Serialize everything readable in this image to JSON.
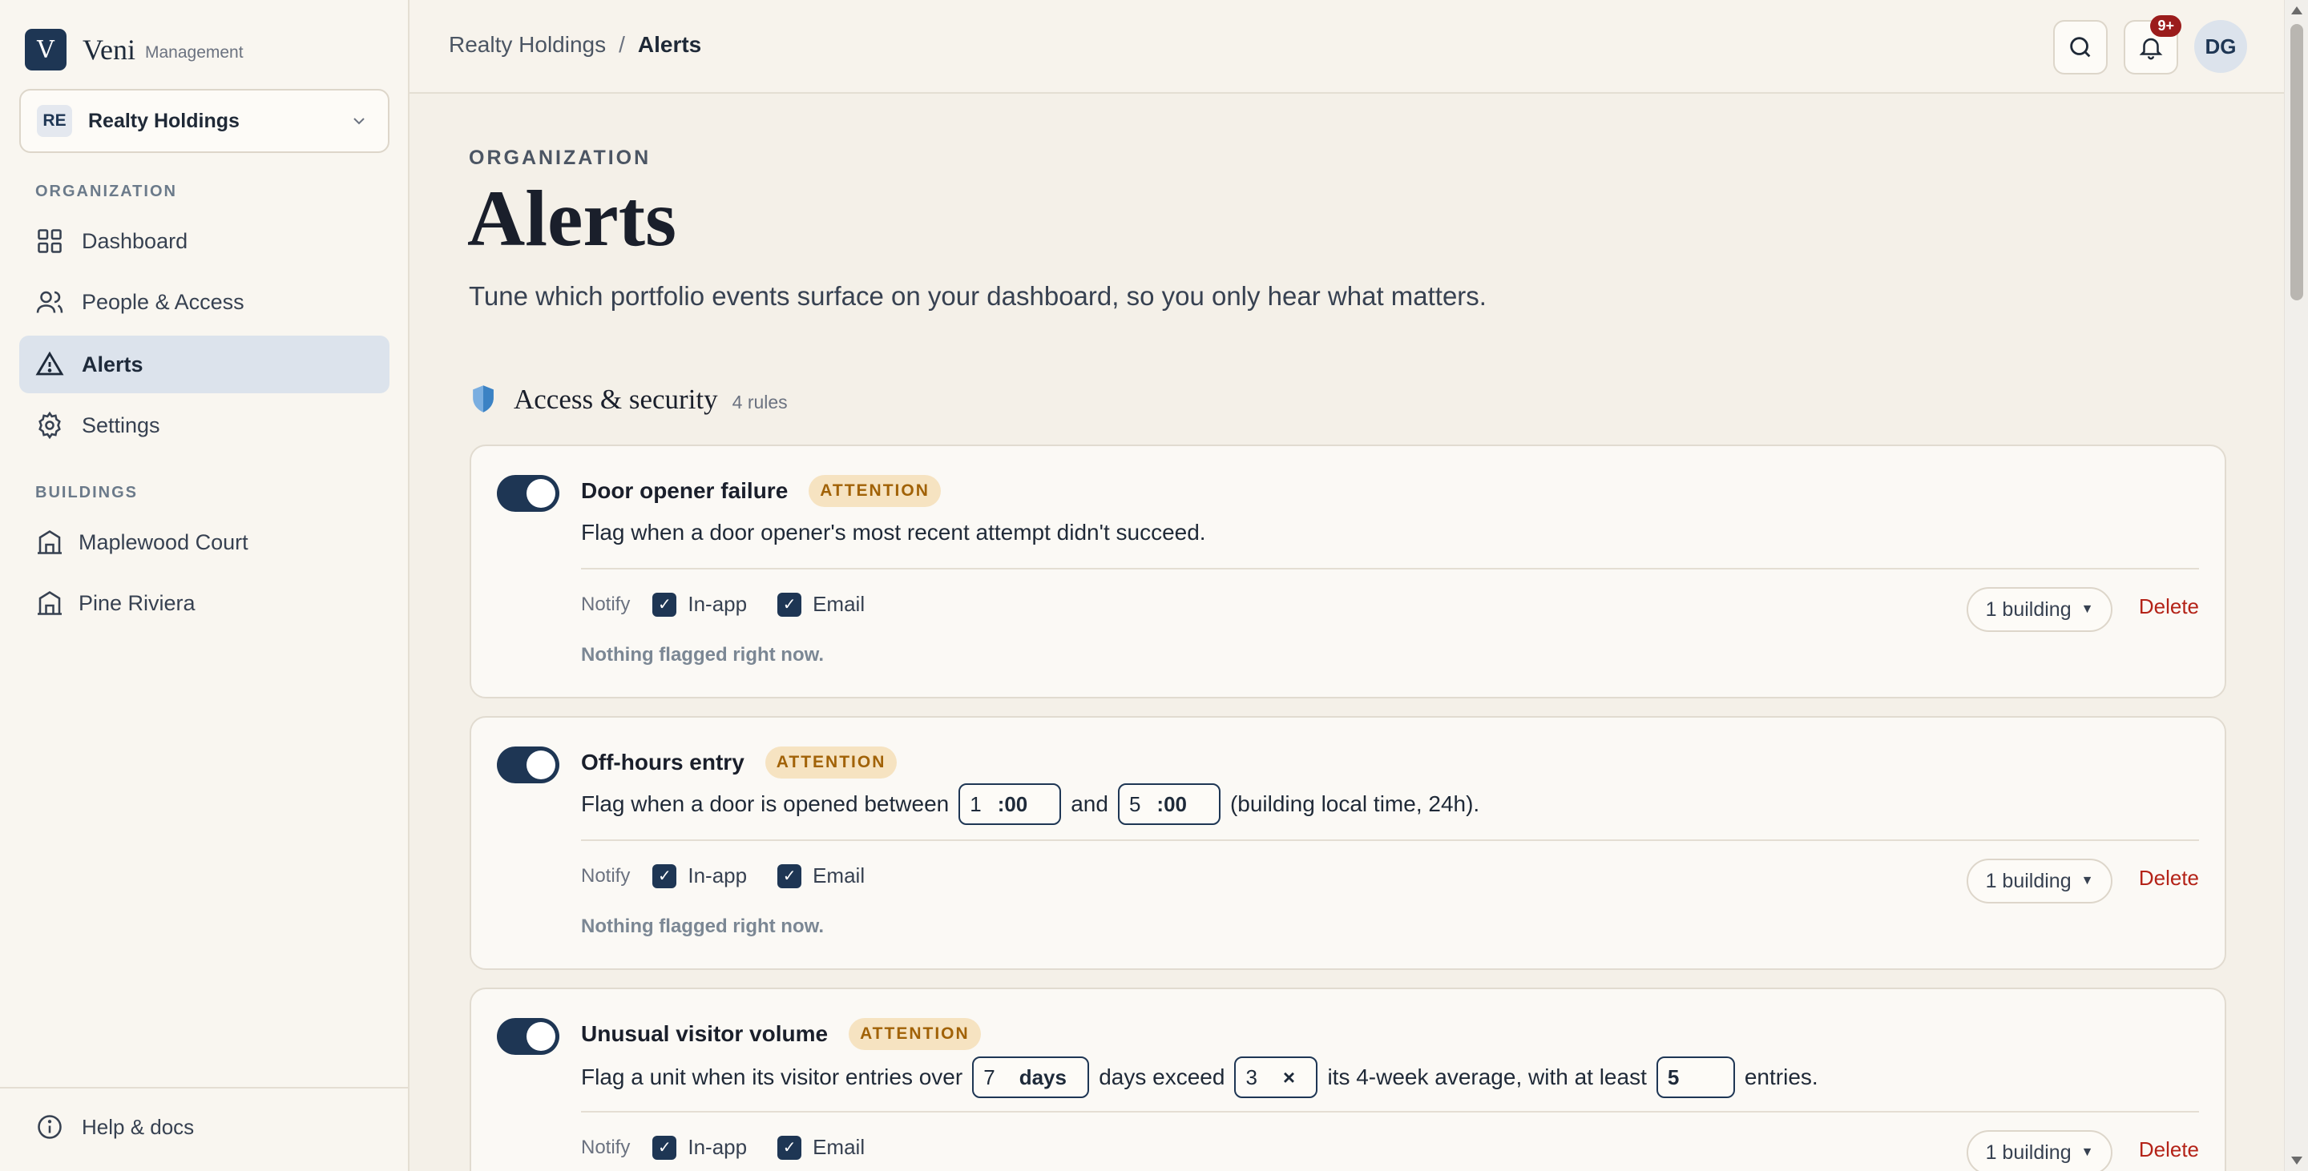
{
  "brand": {
    "logo_letter": "V",
    "name": "Veni",
    "subtitle": "Management"
  },
  "org_selector": {
    "badge": "RE",
    "name": "Realty Holdings"
  },
  "sidebar": {
    "org_heading": "ORGANIZATION",
    "nav": [
      {
        "label": "Dashboard",
        "icon": "grid-icon"
      },
      {
        "label": "People & Access",
        "icon": "users-icon"
      },
      {
        "label": "Alerts",
        "icon": "alert-triangle-icon",
        "active": true
      },
      {
        "label": "Settings",
        "icon": "gear-icon"
      }
    ],
    "buildings_heading": "BUILDINGS",
    "buildings": [
      {
        "label": "Maplewood Court",
        "icon": "building-icon"
      },
      {
        "label": "Pine Riviera",
        "icon": "building-icon"
      }
    ],
    "help": "Help & docs"
  },
  "topbar": {
    "breadcrumb": [
      "Realty Holdings",
      "Alerts"
    ],
    "separator": "/",
    "notification_badge": "9+",
    "avatar": "DG"
  },
  "page": {
    "eyebrow": "ORGANIZATION",
    "title": "Alerts",
    "description": "Tune which portfolio events surface on your dashboard, so you only hear what matters."
  },
  "section": {
    "title": "Access & security",
    "count": "4 rules",
    "icon_color": "#3b82c4"
  },
  "common": {
    "notify_label": "Notify",
    "in_app": "In-app",
    "email": "Email",
    "building_select": "1 building",
    "delete": "Delete",
    "nothing_flagged": "Nothing flagged right now.",
    "check_glyph": "✓"
  },
  "rules": [
    {
      "title": "Door opener failure",
      "tag": "ATTENTION",
      "enabled": true,
      "description": "Flag when a door opener's most recent attempt didn't succeed."
    },
    {
      "title": "Off-hours entry",
      "tag": "ATTENTION",
      "enabled": true,
      "desc_prefix": "Flag when a door is opened between",
      "start_hour": "1",
      "time_suffix": ":00",
      "desc_and": "and",
      "end_hour": "5",
      "desc_suffix": "(building local time, 24h)."
    },
    {
      "title": "Unusual visitor volume",
      "tag": "ATTENTION",
      "enabled": true,
      "desc_prefix": "Flag a unit when its visitor entries over",
      "days": "7",
      "days_suffix": "days",
      "desc_mid": "days exceed",
      "multiplier": "3",
      "multiplier_suffix": "×",
      "desc_mid2": "its 4-week average, with at least",
      "min_entries": "5",
      "desc_suffix": "entries."
    }
  ],
  "colors": {
    "accent": "#1e3654",
    "attention_bg": "#f6e3c1",
    "attention_text": "#a16207",
    "danger": "#b42318"
  }
}
